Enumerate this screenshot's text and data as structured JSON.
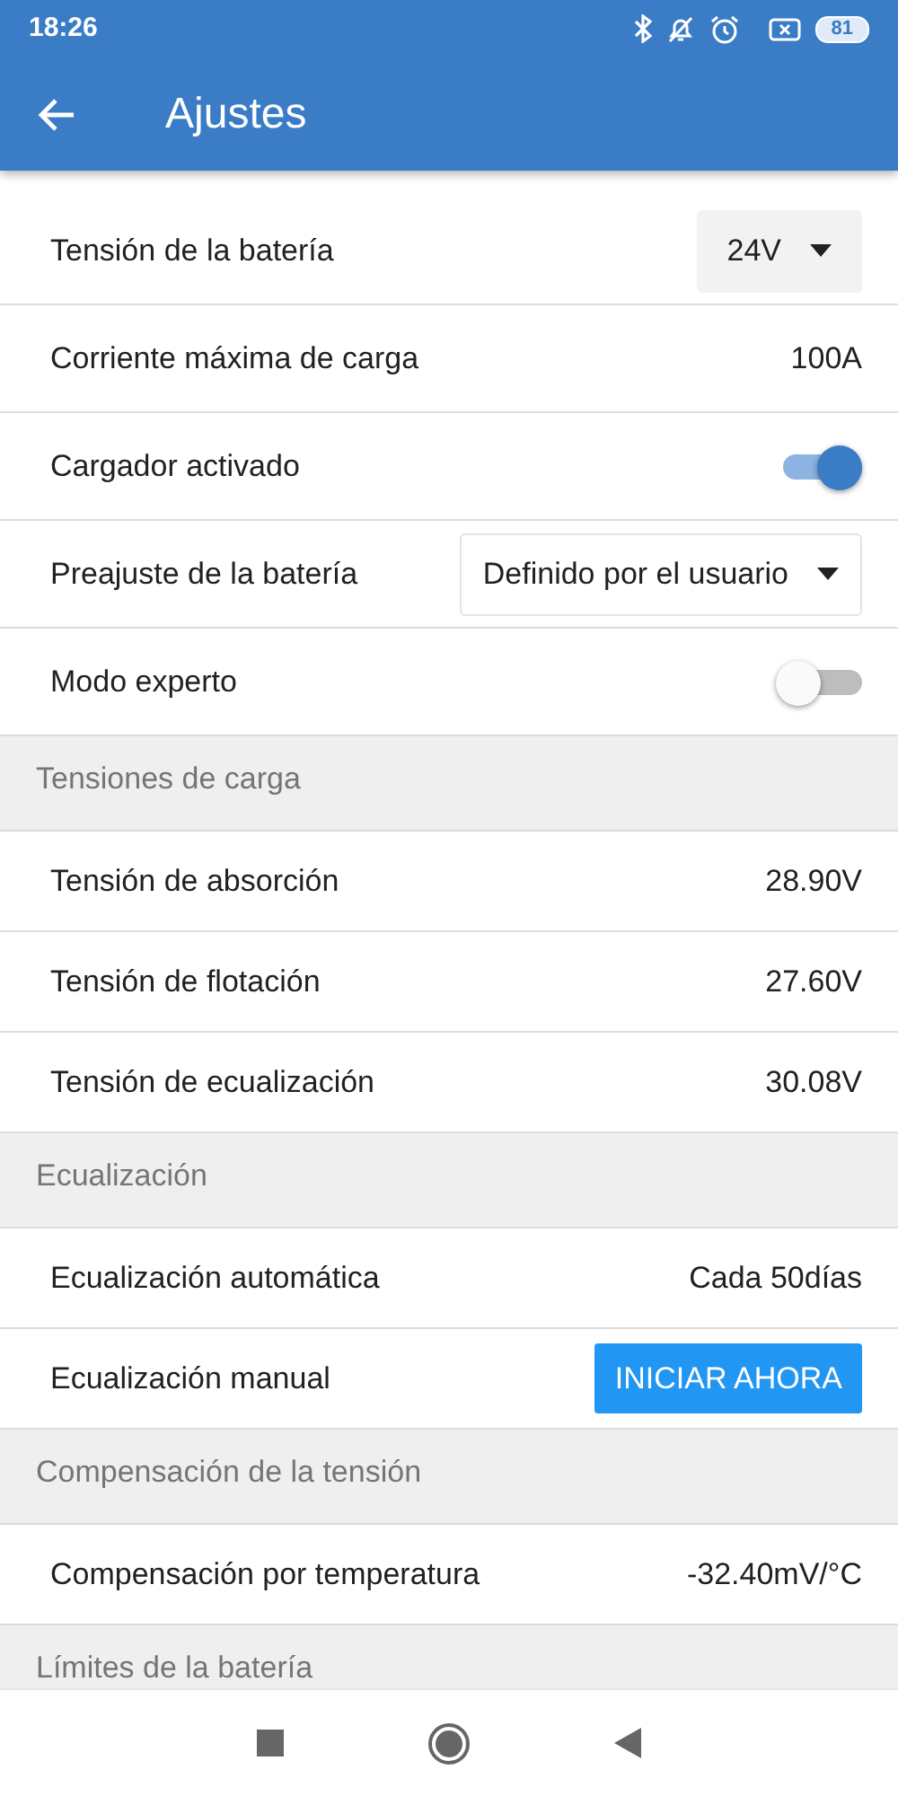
{
  "status_bar": {
    "time": "18:26",
    "battery": "81"
  },
  "app_bar": {
    "title": "Ajustes"
  },
  "sections": [
    {
      "rows": [
        {
          "kind": "select",
          "label": "Tensión de la batería",
          "value": "24V",
          "filled": true
        },
        {
          "kind": "value",
          "label": "Corriente máxima de carga",
          "value": "100A"
        },
        {
          "kind": "toggle",
          "label": "Cargador activado",
          "on": true
        },
        {
          "kind": "select",
          "label": "Preajuste de la batería",
          "value": "Definido por el usuario",
          "filled": false
        },
        {
          "kind": "toggle",
          "label": "Modo experto",
          "on": false
        }
      ]
    },
    {
      "header": "Tensiones de carga",
      "rows": [
        {
          "kind": "value",
          "label": "Tensión de absorción",
          "value": "28.90V"
        },
        {
          "kind": "value",
          "label": "Tensión de flotación",
          "value": "27.60V"
        },
        {
          "kind": "value",
          "label": "Tensión de ecualización",
          "value": "30.08V"
        }
      ]
    },
    {
      "header": "Ecualización",
      "rows": [
        {
          "kind": "value",
          "label": "Ecualización automática",
          "value": "Cada 50días"
        },
        {
          "kind": "button",
          "label": "Ecualización manual",
          "value": "INICIAR AHORA"
        }
      ]
    },
    {
      "header": "Compensación de la tensión",
      "rows": [
        {
          "kind": "value",
          "label": "Compensación por temperatura",
          "value": "-32.40mV/°C"
        }
      ]
    },
    {
      "header": "Límites de la batería"
    }
  ]
}
